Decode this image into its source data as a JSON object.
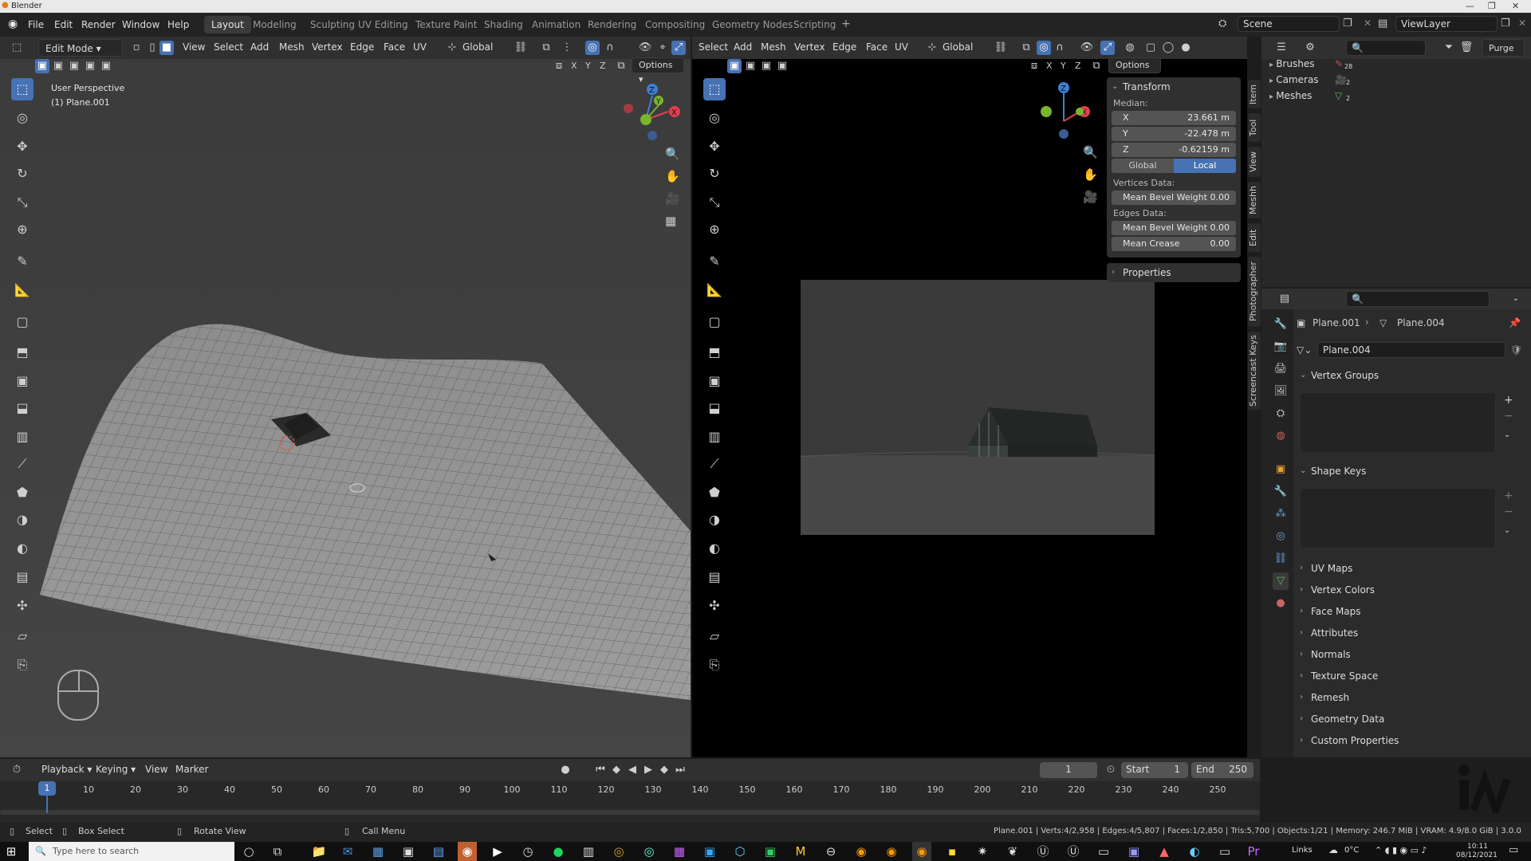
{
  "window": {
    "title": "Blender"
  },
  "menus": [
    "File",
    "Edit",
    "Render",
    "Window",
    "Help"
  ],
  "workspaces": [
    "Layout",
    "Modeling",
    "Sculpting",
    "UV Editing",
    "Texture Paint",
    "Shading",
    "Animation",
    "Rendering",
    "Compositing",
    "Geometry Nodes",
    "Scripting"
  ],
  "scene": {
    "name": "Scene",
    "view_layer": "ViewLayer"
  },
  "left_viewport": {
    "mode": "Edit Mode",
    "menus": [
      "View",
      "Select",
      "Add",
      "Mesh",
      "Vertex",
      "Edge",
      "Face",
      "UV"
    ],
    "orientation": "Global",
    "options": "Options",
    "overlay_line1": "User Perspective",
    "overlay_line2": "(1) Plane.001",
    "axes": [
      "X",
      "Y",
      "Z"
    ]
  },
  "right_viewport": {
    "menus": [
      "Select",
      "Add",
      "Mesh",
      "Vertex",
      "Edge",
      "Face",
      "UV"
    ],
    "orientation": "Global",
    "options": "Options",
    "axes": [
      "X",
      "Y",
      "Z"
    ]
  },
  "transform_panel": {
    "title": "Transform",
    "median_label": "Median:",
    "x_label": "X",
    "x_value": "23.661 m",
    "y_label": "Y",
    "y_value": "-22.478 m",
    "z_label": "Z",
    "z_value": "-0.62159 m",
    "global_btn": "Global",
    "local_btn": "Local",
    "vertices_data": "Vertices Data:",
    "v_bevel_label": "Mean Bevel Weight",
    "v_bevel_value": "0.00",
    "edges_data": "Edges Data:",
    "e_bevel_label": "Mean Bevel Weight",
    "e_bevel_value": "0.00",
    "crease_label": "Mean Crease",
    "crease_value": "0.00",
    "properties": "Properties"
  },
  "side_tabs": [
    "Item",
    "Tool",
    "View",
    "Meshh",
    "Edit",
    "Photographer",
    "Screencast Keys"
  ],
  "outliner": {
    "purge": "Purge",
    "items": [
      {
        "label": "Brushes",
        "badge": "28"
      },
      {
        "label": "Cameras",
        "badge": "2"
      },
      {
        "label": "Meshes",
        "badge": "2"
      }
    ]
  },
  "properties": {
    "breadcrumb_object": "Plane.001",
    "breadcrumb_data": "Plane.004",
    "mesh_name": "Plane.004",
    "vertex_groups": "Vertex Groups",
    "shape_keys": "Shape Keys",
    "sections": [
      "UV Maps",
      "Vertex Colors",
      "Face Maps",
      "Attributes",
      "Normals",
      "Texture Space",
      "Remesh",
      "Geometry Data",
      "Custom Properties"
    ]
  },
  "timeline": {
    "menus": [
      "Playback",
      "Keying",
      "View",
      "Marker"
    ],
    "current_frame": "1",
    "start_label": "Start",
    "start_value": "1",
    "end_label": "End",
    "end_value": "250",
    "ticks": [
      "10",
      "20",
      "30",
      "40",
      "50",
      "60",
      "70",
      "80",
      "90",
      "100",
      "110",
      "120",
      "130",
      "140",
      "150",
      "160",
      "170",
      "180",
      "190",
      "200",
      "210",
      "220",
      "230",
      "240",
      "250"
    ],
    "playhead": "1"
  },
  "statusbar": {
    "select": "Select",
    "box_select": "Box Select",
    "rotate_view": "Rotate View",
    "call_menu": "Call Menu",
    "stats": "Plane.001 | Verts:4/2,958 | Edges:4/5,807 | Faces:1/2,850 | Tris:5,700 | Objects:1/21 | Memory: 246.7 MiB | VRAM: 4.9/8.0 GiB | 3.0.0"
  },
  "taskbar": {
    "search_placeholder": "Type here to search",
    "links": "Links",
    "temperature": "0°C",
    "time": "10:11",
    "date": "08/12/2021"
  },
  "colors": {
    "accent": "#4772b3",
    "x_axis": "#e0404f",
    "y_axis": "#7ab52e",
    "z_axis": "#3f7fd4"
  }
}
